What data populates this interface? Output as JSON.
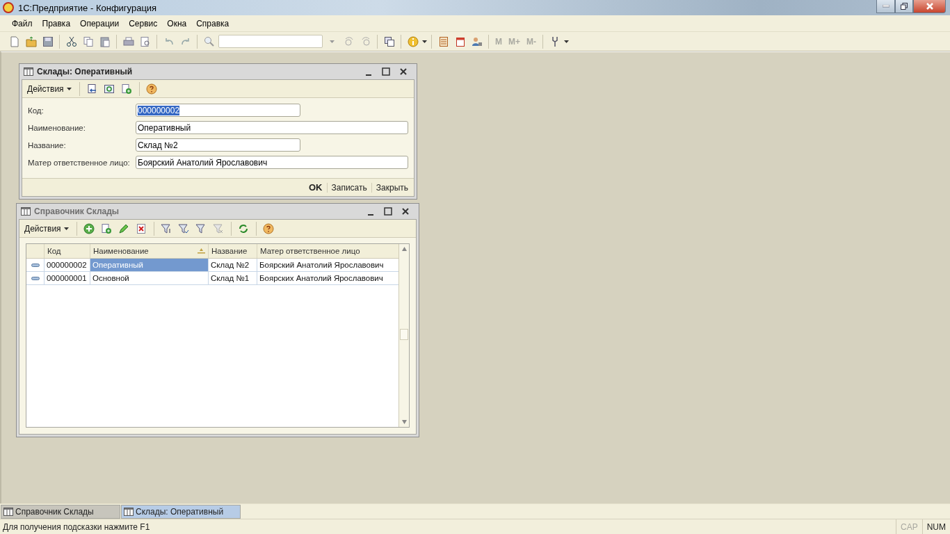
{
  "window": {
    "title": "1С:Предприятие - Конфигурация"
  },
  "menu": [
    {
      "label": "Файл"
    },
    {
      "label": "Правка"
    },
    {
      "label": "Операции"
    },
    {
      "label": "Сервис"
    },
    {
      "label": "Окна"
    },
    {
      "label": "Справка"
    }
  ],
  "toolbar": {
    "memory_buttons": [
      {
        "label": "M"
      },
      {
        "label": "M+"
      },
      {
        "label": "M-"
      }
    ]
  },
  "form_window": {
    "title": "Склады: Оперативный",
    "active": true,
    "actions": "Действия",
    "fields": [
      {
        "label": "Код:",
        "value": "000000002",
        "kind": "short",
        "selected": true
      },
      {
        "label": "Наименование:",
        "value": "Оперативный",
        "kind": "long",
        "selected": false
      },
      {
        "label": "Название:",
        "value": "Склад №2",
        "kind": "short",
        "selected": false
      },
      {
        "label": "Матер ответственное лицо:",
        "value": "Боярский Анатолий Ярославович",
        "kind": "long",
        "selected": false
      }
    ],
    "buttons": [
      {
        "label": "OK",
        "default": true
      },
      {
        "label": "Записать",
        "default": false
      },
      {
        "label": "Закрыть",
        "default": false
      }
    ]
  },
  "list_window": {
    "title": "Справочник Склады",
    "active": false,
    "actions": "Действия",
    "table": {
      "columns": [
        {
          "label": "Код",
          "sorted": false
        },
        {
          "label": "Наименование",
          "sorted": true
        },
        {
          "label": "Название",
          "sorted": false
        },
        {
          "label": "Матер ответственное лицо",
          "sorted": false
        }
      ],
      "rows": [
        {
          "cells": [
            {
              "text": "000000002",
              "selected": false
            },
            {
              "text": "Оперативный",
              "selected": true
            },
            {
              "text": "Склад №2",
              "selected": false
            },
            {
              "text": "Боярский Анатолий Ярославович",
              "selected": false
            }
          ]
        },
        {
          "cells": [
            {
              "text": "000000001",
              "selected": false
            },
            {
              "text": "Основной",
              "selected": false
            },
            {
              "text": "Склад №1",
              "selected": false
            },
            {
              "text": "Боярских Анатолий Ярославович",
              "selected": false
            }
          ]
        }
      ]
    }
  },
  "taskbar": [
    {
      "label": "Справочник Склады",
      "selected": false
    },
    {
      "label": "Склады: Оперативный",
      "selected": true
    }
  ],
  "status_bar": {
    "hint": "Для получения подсказки нажмите F1",
    "indicators": [
      {
        "label": "CAP",
        "on": false
      },
      {
        "label": "NUM",
        "on": true
      }
    ]
  }
}
